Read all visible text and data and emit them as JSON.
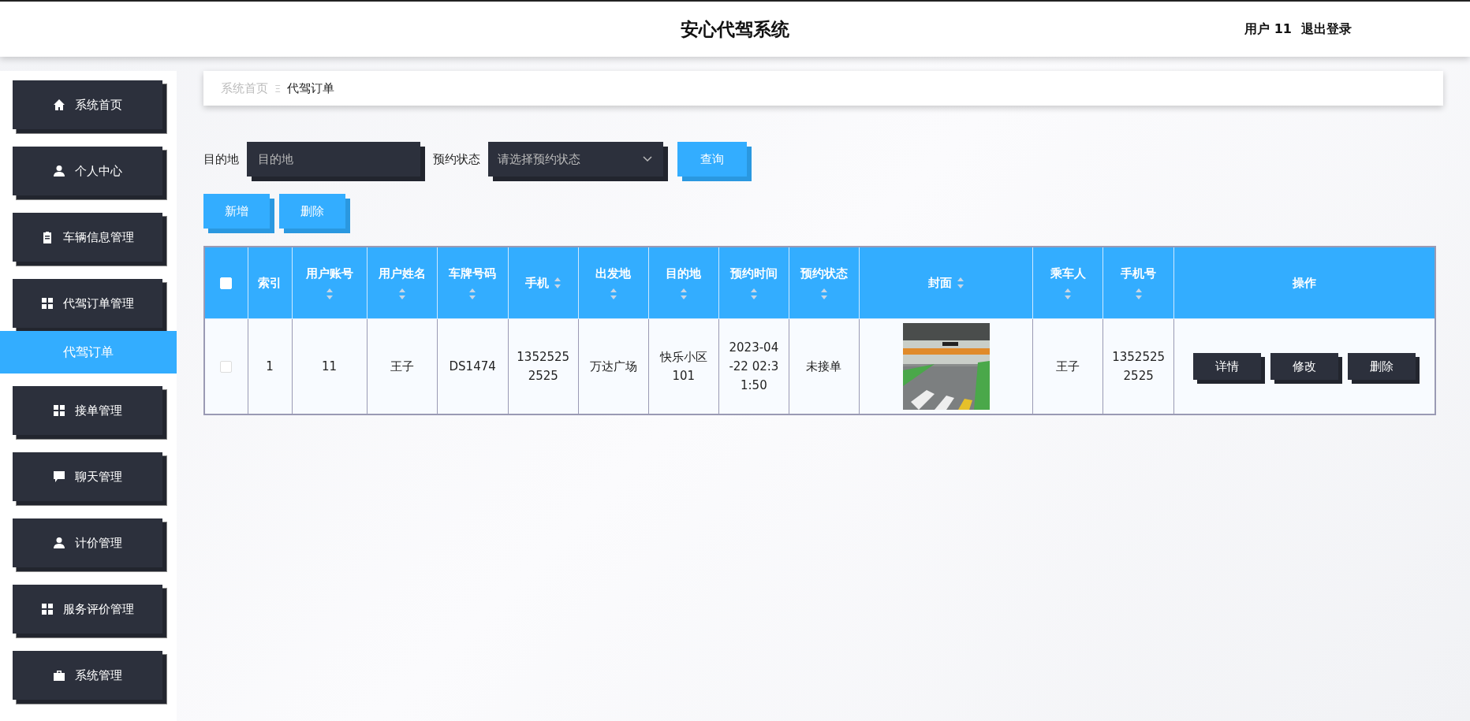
{
  "header": {
    "title": "安心代驾系统",
    "user": "用户 11",
    "logout": "退出登录"
  },
  "sidebar": {
    "items": [
      {
        "label": "系统首页",
        "selected": false
      },
      {
        "label": "个人中心",
        "selected": false
      },
      {
        "label": "车辆信息管理",
        "selected": false
      },
      {
        "label": "代驾订单管理",
        "selected": false,
        "expanded": true,
        "children": [
          {
            "label": "代驾订单",
            "selected": true
          }
        ]
      },
      {
        "label": "接单管理",
        "selected": false
      },
      {
        "label": "聊天管理",
        "selected": false
      },
      {
        "label": "计价管理",
        "selected": false
      },
      {
        "label": "服务评价管理",
        "selected": false
      },
      {
        "label": "系统管理",
        "selected": false
      }
    ]
  },
  "breadcrumb": {
    "items": [
      "系统首页",
      "代驾订单"
    ],
    "separator": "Ξ"
  },
  "search": {
    "fields": [
      {
        "kind": "input",
        "label": "目的地",
        "placeholder": "目的地"
      },
      {
        "kind": "select",
        "label": "预约状态",
        "placeholder": "请选择预约状态"
      }
    ],
    "button": "查询"
  },
  "actions": [
    "新增",
    "删除"
  ],
  "table": {
    "header_checked": false,
    "columns": [
      {
        "label": "索引",
        "kind": "plain"
      },
      {
        "label": "用户账号",
        "kind": "sortable"
      },
      {
        "label": "用户姓名",
        "kind": "sortable"
      },
      {
        "label": "车牌号码",
        "kind": "sortable"
      },
      {
        "label": "手机",
        "kind": "inline"
      },
      {
        "label": "出发地",
        "kind": "sortable"
      },
      {
        "label": "目的地",
        "kind": "sortable"
      },
      {
        "label": "预约时间",
        "kind": "sortable"
      },
      {
        "label": "预约状态",
        "kind": "sortable"
      },
      {
        "label": "封面",
        "kind": "inline"
      },
      {
        "label": "乘车人",
        "kind": "sortable"
      },
      {
        "label": "手机号",
        "kind": "sortable"
      },
      {
        "label": "操作",
        "kind": "plain"
      }
    ],
    "rows": [
      {
        "checked": false,
        "cells": [
          {
            "kind": "text",
            "text": "1"
          },
          {
            "kind": "text",
            "text": "11"
          },
          {
            "kind": "text",
            "text": "王子"
          },
          {
            "kind": "text",
            "text": "DS1474"
          },
          {
            "kind": "text",
            "text": "13525252525"
          },
          {
            "kind": "text",
            "text": "万达广场"
          },
          {
            "kind": "text",
            "text": "快乐小区101"
          },
          {
            "kind": "text",
            "text": "2023-04-22 02:31:50"
          },
          {
            "kind": "text",
            "text": "未接单"
          },
          {
            "kind": "picture"
          },
          {
            "kind": "text",
            "text": "王子"
          },
          {
            "kind": "text",
            "text": "13525252525"
          },
          {
            "kind": "buttons",
            "buttons": [
              "详情",
              "修改",
              "删除"
            ]
          }
        ]
      }
    ]
  }
}
